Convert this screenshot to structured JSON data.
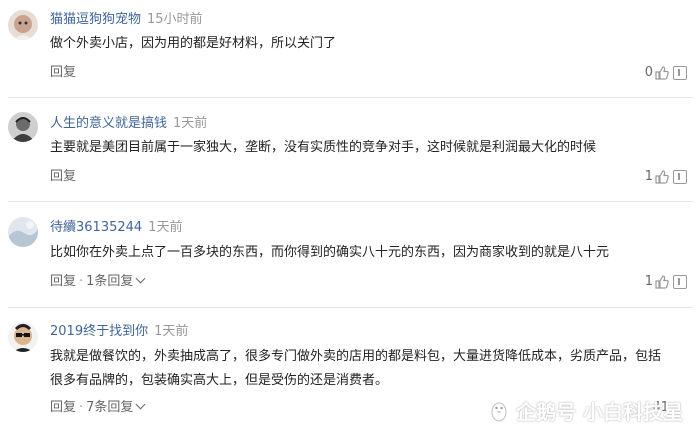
{
  "comments": [
    {
      "username": "猫猫逗狗狗宠物",
      "time": "15小时前",
      "content": "做个外卖小店，因为用的都是好材料，所以关门了",
      "reply_label": "回复",
      "likes": "0"
    },
    {
      "username": "人生的意义就是搞钱",
      "time": "1天前",
      "content": "主要就是美团目前属于一家独大，垄断，没有实质性的竞争对手，这时候就是利润最大化的时候",
      "reply_label": "回复",
      "likes": "1"
    },
    {
      "username": "待續36135244",
      "time": "1天前",
      "content": "比如你在外卖上点了一百多块的东西，而你得到的确实八十元的东西，因为商家收到的就是八十元",
      "reply_label": "回复",
      "reply_count": "1条回复",
      "likes": "1"
    },
    {
      "username": "2019终于找到你",
      "time": "1天前",
      "content": "我就是做餐饮的，外卖抽成高了，很多专门做外卖的店用的都是料包，大量进货降低成本，劣质产品，包括很多有品牌的，包装确实高大上，但是受伤的还是消费者。",
      "reply_label": "回复",
      "reply_count": "7条回复",
      "likes": "41"
    }
  ],
  "watermark": {
    "text": "企鹅号 小白科技星"
  },
  "icons": {
    "like": "thumbs-up-icon",
    "report": "report-icon",
    "more": "chevron-down-icon"
  }
}
